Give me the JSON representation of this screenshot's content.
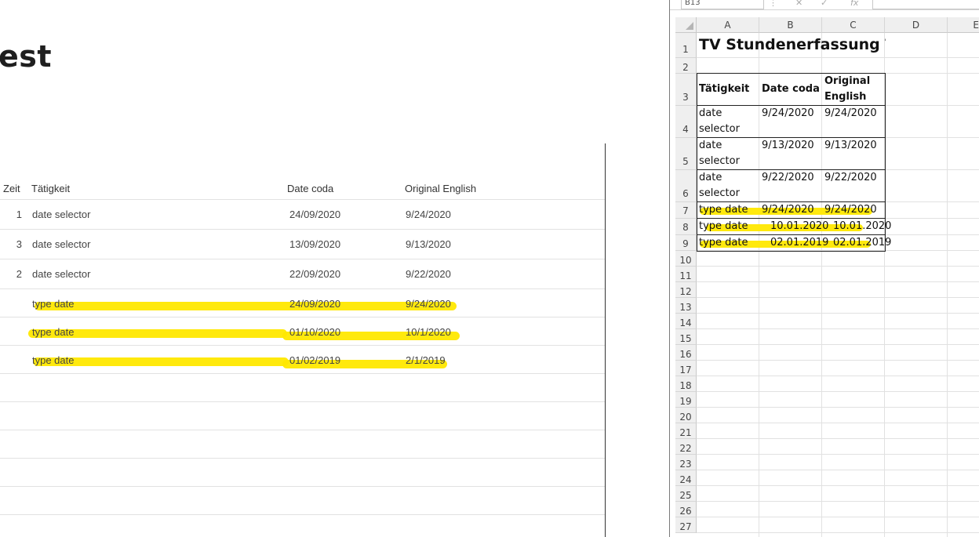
{
  "coda": {
    "title_fragment": "est",
    "headers": {
      "zeit": "Zeit",
      "taetigkeit": "Tätigkeit",
      "date_coda": "Date coda",
      "original_english": "Original English"
    },
    "rows": [
      {
        "zeit": "1",
        "taetigkeit": "date selector",
        "date_coda": "24/09/2020",
        "original_english": "9/24/2020"
      },
      {
        "zeit": "3",
        "taetigkeit": "date selector",
        "date_coda": "13/09/2020",
        "original_english": "9/13/2020"
      },
      {
        "zeit": "2",
        "taetigkeit": "date selector",
        "date_coda": "22/09/2020",
        "original_english": "9/22/2020"
      },
      {
        "zeit": "",
        "taetigkeit": "type date",
        "date_coda": "24/09/2020",
        "original_english": "9/24/2020"
      },
      {
        "zeit": "",
        "taetigkeit": "type date",
        "date_coda": "01/10/2020",
        "original_english": "10/1/2020"
      },
      {
        "zeit": "",
        "taetigkeit": "type date",
        "date_coda": "01/02/2019",
        "original_english": "2/1/2019"
      }
    ],
    "highlight_color": "#ffe800"
  },
  "excel": {
    "name_box": "B13",
    "fx_label": "fx",
    "columns": [
      "A",
      "B",
      "C",
      "D",
      "E"
    ],
    "row_numbers": [
      "1",
      "2",
      "3",
      "4",
      "5",
      "6",
      "7",
      "8",
      "9",
      "10",
      "11",
      "12",
      "13",
      "14",
      "15",
      "16",
      "17",
      "18",
      "19",
      "20",
      "21",
      "22",
      "23",
      "24",
      "25",
      "26",
      "27"
    ],
    "title": "TV Stundenerfassung TE",
    "header": {
      "a": "Tätigkeit",
      "b": "Date coda",
      "c1": "Original",
      "c2": "English"
    },
    "rows": [
      {
        "a1": "date",
        "a2": "selector",
        "b": "9/24/2020",
        "c": "9/24/2020"
      },
      {
        "a1": "date",
        "a2": "selector",
        "b": "9/13/2020",
        "c": "9/13/2020"
      },
      {
        "a1": "date",
        "a2": "selector",
        "b": "9/22/2020",
        "c": "9/22/2020"
      },
      {
        "a1": "type date",
        "b": "9/24/2020",
        "c": "9/24/2020"
      },
      {
        "a1": "type date",
        "b": "10.01.2020",
        "c": "10.01.2020"
      },
      {
        "a1": "type date",
        "b": "02.01.2019",
        "c": "02.01.2019"
      }
    ]
  }
}
